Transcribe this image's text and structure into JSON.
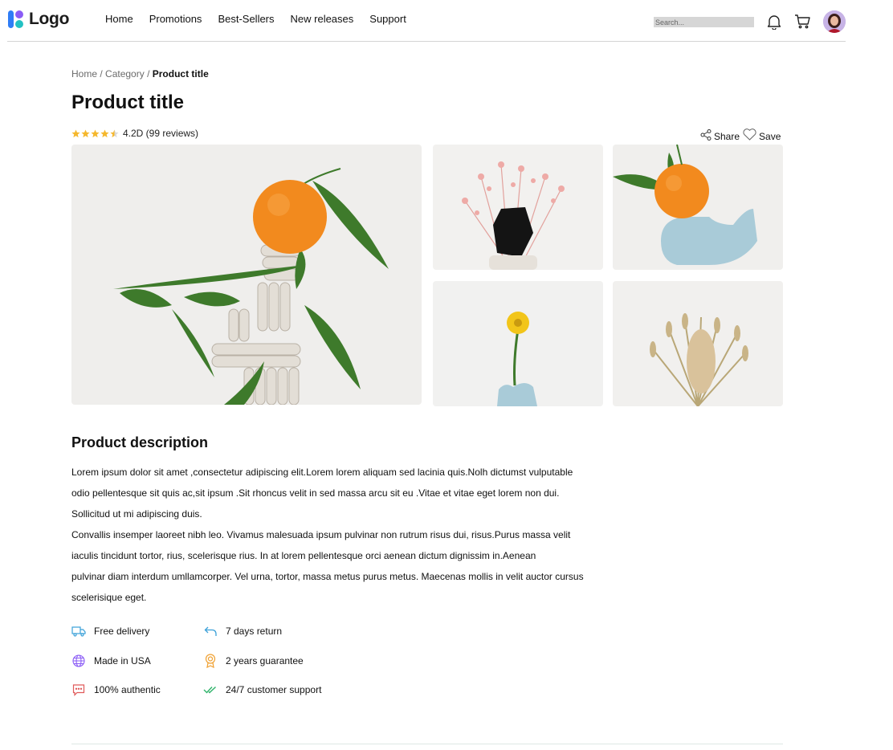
{
  "header": {
    "logo_text": "Logo",
    "nav": [
      "Home",
      "Promotions",
      "Best-Sellers",
      "New releases",
      "Support"
    ],
    "search_placeholder": "Search..."
  },
  "breadcrumb": {
    "home": "Home",
    "sep1": " / ",
    "category": "Category",
    "sep2": " / ",
    "current": "Product title"
  },
  "product": {
    "title": "Product title",
    "rating": 4.2,
    "rating_text": "4.2D (99 reviews)",
    "share_label": "Share",
    "save_label": "Save"
  },
  "gallery": {
    "images": [
      "orange-on-sculpture",
      "pink-dried-flowers-black-stone",
      "orange-on-blue-vase",
      "yellow-flower-blue-vase",
      "dried-grass-bouquet"
    ]
  },
  "description": {
    "title": "Product description",
    "lines": [
      "Lorem ipsum dolor sit amet ,consectetur adipiscing elit.Lorem lorem aliquam sed lacinia quis.Nolh dictumst vulputable",
      "odio pellentesque sit quis ac,sit ipsum .Sit rhoncus velit in sed massa arcu sit eu .Vitae et vitae eget lorem non dui.",
      "Sollicitud ut mi adipiscing duis.",
      "Convallis insemper laoreet nibh leo. Vivamus malesuada ipsum pulvinar non rutrum risus dui, risus.Purus massa velit",
      "iaculis tincidunt tortor, rius, scelerisque rius. In at lorem pellentesque orci aenean dictum dignissim in.Aenean",
      "pulvinar diam interdum umllamcorper. Vel urna, tortor, massa metus purus metus. Maecenas mollis in velit auctor cursus",
      "scelerisique eget."
    ]
  },
  "features": [
    {
      "label": "Free delivery",
      "icon": "truck-icon",
      "color": "#3aa0d8"
    },
    {
      "label": "7 days return",
      "icon": "return-arrow-icon",
      "color": "#3aa0d8"
    },
    {
      "label": "Made in USA",
      "icon": "globe-icon",
      "color": "#8b5cf6"
    },
    {
      "label": "2 years guarantee",
      "icon": "award-icon",
      "color": "#f0a030"
    },
    {
      "label": "100% authentic",
      "icon": "message-icon",
      "color": "#e05a5a"
    },
    {
      "label": "24/7 customer support",
      "icon": "double-check-icon",
      "color": "#2fb36a"
    }
  ]
}
